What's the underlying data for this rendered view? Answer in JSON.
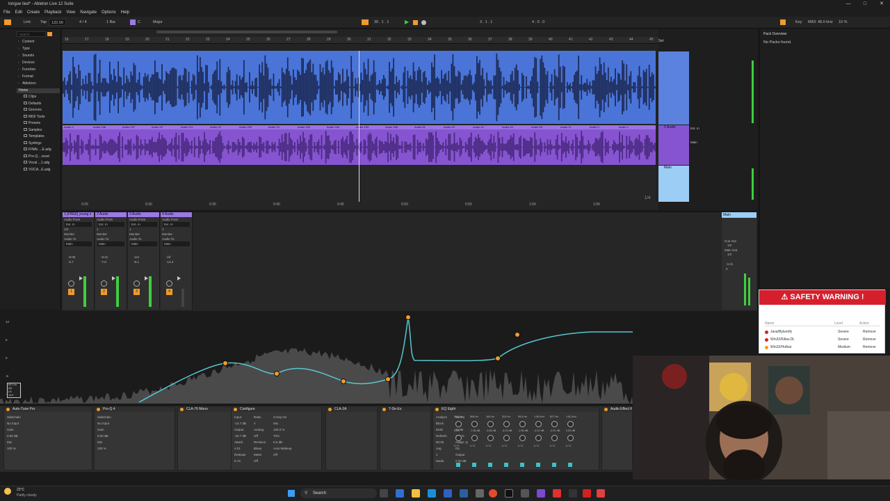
{
  "window": {
    "title": "tongue tied* - Ableton Live 12 Suite"
  },
  "menu": [
    "File",
    "Edit",
    "Create",
    "Playback",
    "View",
    "Navigate",
    "Options",
    "Help"
  ],
  "control_bar": {
    "link": "Link",
    "tap": "Tap",
    "tempo": "132.00",
    "signature": "4 / 4",
    "quantize": "1 Bar",
    "key": "C",
    "scale": "Major",
    "position": "30 . 1 . 1",
    "loop_start": "3 . 1 . 1",
    "loop_len": "4 . 0 . 0",
    "key_label": "Key",
    "midi_label": "MIDI",
    "sample_rate": "48.0 kHz",
    "cpu": "10 %"
  },
  "browser": {
    "search_placeholder": "Search",
    "filters": [
      "Content",
      "Type",
      "Sounds",
      "Devices",
      "Function",
      "Format",
      "Abletoon",
      "VST3"
    ],
    "home": "Home",
    "items": [
      "Clips",
      "Defaults",
      "Grooves",
      "MIDI Tools",
      "Presets",
      "Samples",
      "Templates",
      "Syslings",
      "FINAL ...E.adg",
      "Pro-Q ...reset",
      "Vocal ...1.adg",
      "VOCA...E.adg"
    ]
  },
  "ruler": [
    "16",
    "17",
    "18",
    "19",
    "20",
    "21",
    "22",
    "23",
    "24",
    "25",
    "26",
    "27",
    "28",
    "29",
    "30",
    "31",
    "32",
    "33",
    "34",
    "35",
    "36",
    "37",
    "38",
    "39",
    "40",
    "41",
    "42",
    "43",
    "44",
    "45"
  ],
  "time_ruler": [
    "0:25",
    "0:30",
    "0:35",
    "0:40",
    "0:45",
    "0:50",
    "0:55",
    "1:00",
    "1:05"
  ],
  "tracks": [
    {
      "name": "1 [FREE] young n",
      "clip_labels": []
    },
    {
      "name": "2 Audio",
      "clip_labels": [
        "Audio 2",
        "Audio 238",
        "Audio 237",
        "Audio 29",
        "Audio 211",
        "Audio 20",
        "Audio 209",
        "Audio 19",
        "Audio 183",
        "Audio 184",
        "Audio 153",
        "Audio 168",
        "Audio 81",
        "Audio 40",
        "Audio 42",
        "Audio 40",
        "Audio 28",
        "Audio 21",
        "Audio 3",
        "Audio 2"
      ]
    },
    {
      "name": "Main"
    }
  ],
  "arrangement_right": {
    "set": "Set",
    "audio_track": "2 Audio",
    "ext_in": "Ext. In",
    "in_label": "In",
    "auto": "Auto",
    "off": "Off",
    "main_label": "Main",
    "loop_fraction": "1/4",
    "zoom": "1/2"
  },
  "pack_overview": {
    "title": "Pack Overview",
    "message": "No Packs found."
  },
  "mixer": {
    "channels": [
      {
        "name": "1 [FREE] young n",
        "audio_from": "Audio From",
        "src": "Ext. In",
        "chan": "1/2",
        "monitor": "Monitor",
        "audio_to": "Audio To",
        "dest": "Main",
        "vol": "-9.06",
        "peak": "-6.7",
        "num": "1"
      },
      {
        "name": "2 Audio",
        "audio_from": "Audio From",
        "src": "Ext. In",
        "chan": "1",
        "monitor": "Monitor",
        "audio_to": "Audio To",
        "dest": "Main",
        "vol": "-8.31",
        "peak": "-7.8",
        "num": "2"
      },
      {
        "name": "3 Audio",
        "audio_from": "Audio From",
        "src": "Ext. In",
        "chan": "1",
        "monitor": "Monitor",
        "audio_to": "Audio To",
        "dest": "Main",
        "vol": "-111",
        "peak": "-9.1",
        "num": "3"
      },
      {
        "name": "4 Audio",
        "audio_from": "Audio From",
        "src": "Ext. In",
        "chan": "1",
        "monitor": "Monitor",
        "audio_to": "Audio To",
        "dest": "Main",
        "vol": "-inf",
        "peak": "-14.3",
        "num": "4"
      }
    ],
    "main": {
      "name": "Main",
      "cue_out": "Cue Out",
      "cue_chan": "1/2",
      "main_out": "Main Out",
      "main_chan": "1/2",
      "vol": "-3.31",
      "peak": "0"
    }
  },
  "eq_display": {
    "scale": [
      "12",
      "6",
      "0",
      "-6",
      "-12"
    ],
    "readout": [
      "637 Hz",
      "Q4",
      "LS",
      "14.0"
    ]
  },
  "devices": [
    {
      "name": "Auto-Tune Pro",
      "params": [
        "Sidechain",
        "No Input",
        "Gain",
        "0.00 dB",
        "Mix",
        "100 %"
      ]
    },
    {
      "name": "Pro-Q 4",
      "params": [
        "Sidechain",
        "No Input",
        "Gain",
        "0.00 dB",
        "Mix",
        "100 %"
      ]
    },
    {
      "name": "CLA-76 Mono",
      "params": []
    },
    {
      "name": "Configure",
      "params": [
        "Input",
        "-12.7 dB",
        "Output",
        "-22.7 dB",
        "Attack",
        "4.01",
        "Release",
        "6.73",
        "Ratio",
        "4",
        "Analog",
        "Off",
        "Revision",
        "Bluey",
        "Meter",
        "Off",
        "Comp On",
        "Mix",
        "100.0 %",
        "Trim",
        "0.0 dB",
        "Auto Makeup",
        "Off"
      ]
    },
    {
      "name": "CLA-2A",
      "params": []
    },
    {
      "name": "T-De-Es",
      "params": []
    },
    {
      "name": "EQ Eight",
      "params": [
        "Analyze",
        "Block",
        "8192",
        "Refresh",
        "60.00",
        "Avg",
        "1",
        "Mode",
        "Stereo",
        "Edit",
        "Scale",
        "100 %",
        "Adapt. Q",
        "On",
        "Output",
        "0.00 dB"
      ]
    },
    {
      "name": "Audio Effect Ra...",
      "params": []
    }
  ],
  "eq_eight_bands": {
    "freq": [
      "95.8 Hz",
      "508 Hz",
      "183 Hz",
      "323 Hz",
      "95.8 Hz",
      "1.56 kHz",
      "827 Hz",
      "1.82 kHz"
    ],
    "gain": [
      "0.02",
      "-7.38 dB",
      "-3.48 dB",
      "-6.23 dB",
      "-1.98 dB",
      "-0.12 dB",
      "-0.21 dB",
      "0.00 dB"
    ],
    "q": [
      "0.71",
      "0.71",
      "0.71",
      "0.71",
      "0.71",
      "0.71",
      "0.71",
      "0.71"
    ]
  },
  "safety_warning": {
    "title": "SAFETY WARNING !",
    "headers": [
      "Name",
      "Level",
      "Action"
    ],
    "rows": [
      {
        "name": "Java/Bytverify",
        "level": "Severe",
        "action": "Remove",
        "color": "#d61f2c"
      },
      {
        "name": "Win32/Killav.DL",
        "level": "Severe",
        "action": "Remove",
        "color": "#d61f2c"
      },
      {
        "name": "Win32/Hotbar",
        "level": "Medium",
        "action": "Remove",
        "color": "#f0a020"
      }
    ]
  },
  "taskbar": {
    "weather_temp": "22°C",
    "weather_text": "Partly cloudy",
    "search": "Search"
  },
  "colors": {
    "accent": "#f09b2d",
    "clip_blue": "#4a74d8",
    "clip_purple": "#8654d0",
    "eq_curve": "#56c8d0",
    "warning_red": "#d61f2c"
  }
}
